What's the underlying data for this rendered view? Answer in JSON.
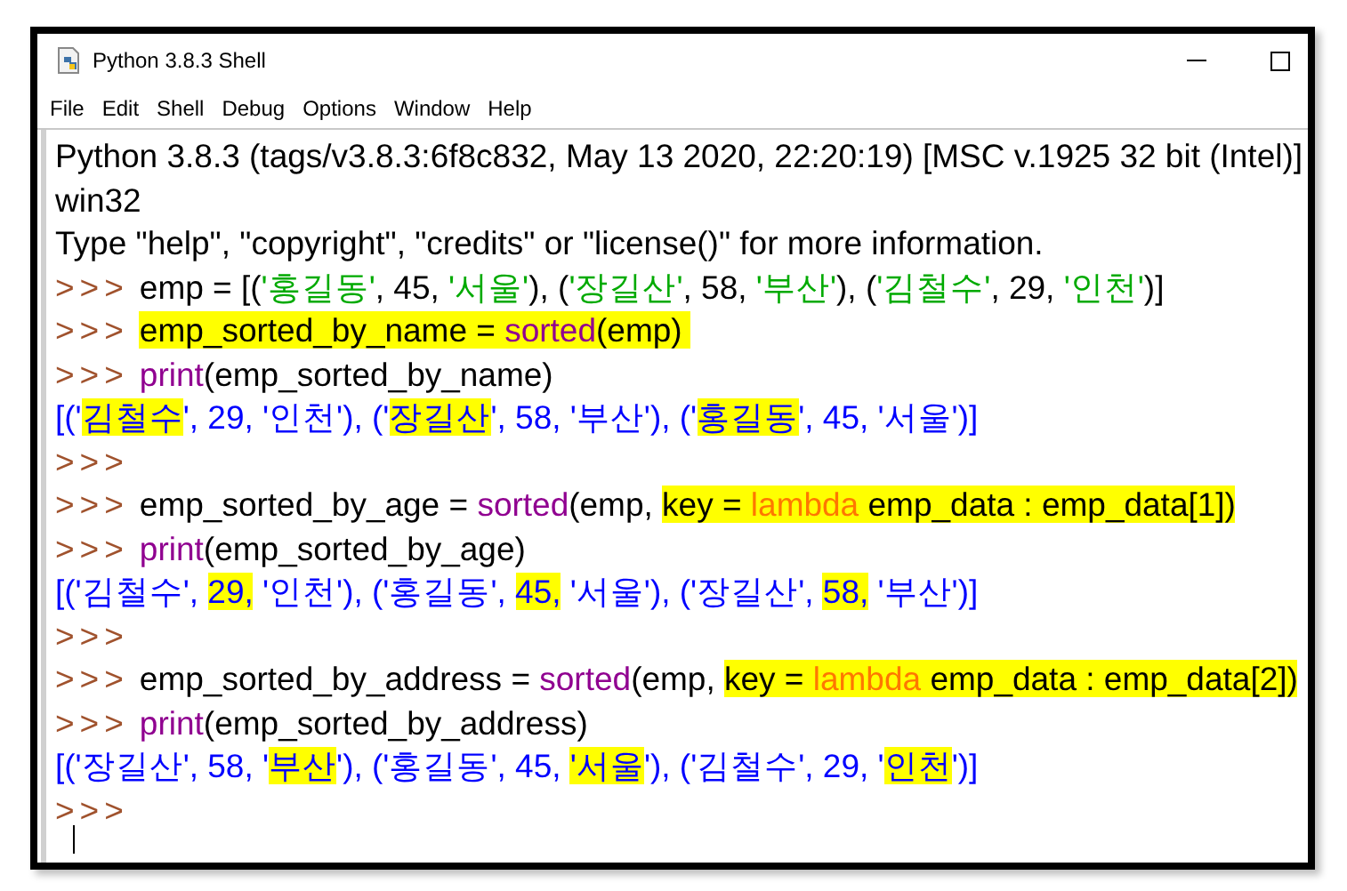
{
  "window": {
    "title": "Python 3.8.3 Shell"
  },
  "menu": [
    "File",
    "Edit",
    "Shell",
    "Debug",
    "Options",
    "Window",
    "Help"
  ],
  "lines": [
    {
      "segments": [
        {
          "text": "Python 3.8.3 (tags/v3.8.3:6f8c832, May 13 2020, 22:20:19) [MSC v.1925 32 bit (Intel)]",
          "kind": "plain",
          "highlighted": false
        }
      ]
    },
    {
      "segments": [
        {
          "text": "win32",
          "kind": "plain",
          "highlighted": false
        }
      ]
    },
    {
      "segments": [
        {
          "text": "Type \"help\", \"copyright\", \"credits\" or \"license()\" for more information.",
          "kind": "plain",
          "highlighted": false
        }
      ]
    },
    {
      "prompt": ">>>",
      "segments": [
        {
          "text": "emp = [(",
          "kind": "plain",
          "highlighted": false
        },
        {
          "text": "'홍길동'",
          "kind": "string",
          "highlighted": false
        },
        {
          "text": ", 45, ",
          "kind": "plain",
          "highlighted": false
        },
        {
          "text": "'서울'",
          "kind": "string",
          "highlighted": false
        },
        {
          "text": "), (",
          "kind": "plain",
          "highlighted": false
        },
        {
          "text": "'장길산'",
          "kind": "string",
          "highlighted": false
        },
        {
          "text": ", 58, ",
          "kind": "plain",
          "highlighted": false
        },
        {
          "text": "'부산'",
          "kind": "string",
          "highlighted": false
        },
        {
          "text": "), (",
          "kind": "plain",
          "highlighted": false
        },
        {
          "text": "'김철수'",
          "kind": "string",
          "highlighted": false
        },
        {
          "text": ", 29, ",
          "kind": "plain",
          "highlighted": false
        },
        {
          "text": "'인천'",
          "kind": "string",
          "highlighted": false
        },
        {
          "text": ")]",
          "kind": "plain",
          "highlighted": false
        }
      ]
    },
    {
      "prompt": ">>>",
      "segments": [
        {
          "text": "emp_sorted_by_name = ",
          "kind": "plain",
          "highlighted": true
        },
        {
          "text": "sorted",
          "kind": "builtin",
          "highlighted": true
        },
        {
          "text": "(emp) ",
          "kind": "plain",
          "highlighted": true
        }
      ]
    },
    {
      "prompt": ">>>",
      "segments": [
        {
          "text": "print",
          "kind": "builtin",
          "highlighted": false
        },
        {
          "text": "(emp_sorted_by_name)",
          "kind": "plain",
          "highlighted": false
        }
      ]
    },
    {
      "segments": [
        {
          "text": "[('",
          "kind": "output",
          "highlighted": false
        },
        {
          "text": "김철수",
          "kind": "output",
          "highlighted": true
        },
        {
          "text": "', 29, '인천'), ('",
          "kind": "output",
          "highlighted": false
        },
        {
          "text": "장길산",
          "kind": "output",
          "highlighted": true
        },
        {
          "text": "', 58, '부산'), ('",
          "kind": "output",
          "highlighted": false
        },
        {
          "text": "홍길동",
          "kind": "output",
          "highlighted": true
        },
        {
          "text": "', 45, '서울')]",
          "kind": "output",
          "highlighted": false
        }
      ]
    },
    {
      "prompt": ">>>"
    },
    {
      "prompt": ">>>",
      "segments": [
        {
          "text": "emp_sorted_by_age = ",
          "kind": "plain",
          "highlighted": false
        },
        {
          "text": "sorted",
          "kind": "builtin",
          "highlighted": false
        },
        {
          "text": "(emp, ",
          "kind": "plain",
          "highlighted": false
        },
        {
          "text": "key = ",
          "kind": "plain",
          "highlighted": true
        },
        {
          "text": "lambda",
          "kind": "keyword",
          "highlighted": true
        },
        {
          "text": " emp_data : emp_data[1])",
          "kind": "plain",
          "highlighted": true
        }
      ]
    },
    {
      "prompt": ">>>",
      "segments": [
        {
          "text": "print",
          "kind": "builtin",
          "highlighted": false
        },
        {
          "text": "(emp_sorted_by_age)",
          "kind": "plain",
          "highlighted": false
        }
      ]
    },
    {
      "segments": [
        {
          "text": "[('김철수', ",
          "kind": "output",
          "highlighted": false
        },
        {
          "text": "29,",
          "kind": "output",
          "highlighted": true
        },
        {
          "text": " '인천'), ('홍길동', ",
          "kind": "output",
          "highlighted": false
        },
        {
          "text": "45,",
          "kind": "output",
          "highlighted": true
        },
        {
          "text": " '서울'), ('장길산', ",
          "kind": "output",
          "highlighted": false
        },
        {
          "text": "58,",
          "kind": "output",
          "highlighted": true
        },
        {
          "text": " '부산')]",
          "kind": "output",
          "highlighted": false
        }
      ]
    },
    {
      "prompt": ">>>"
    },
    {
      "prompt": ">>>",
      "segments": [
        {
          "text": "emp_sorted_by_address = ",
          "kind": "plain",
          "highlighted": false
        },
        {
          "text": "sorted",
          "kind": "builtin",
          "highlighted": false
        },
        {
          "text": "(emp, ",
          "kind": "plain",
          "highlighted": false
        },
        {
          "text": "key = ",
          "kind": "plain",
          "highlighted": true
        },
        {
          "text": "lambda",
          "kind": "keyword",
          "highlighted": true
        },
        {
          "text": " emp_data : emp_data[2])",
          "kind": "plain",
          "highlighted": true
        }
      ]
    },
    {
      "prompt": ">>>",
      "segments": [
        {
          "text": "print",
          "kind": "builtin",
          "highlighted": false
        },
        {
          "text": "(emp_sorted_by_address)",
          "kind": "plain",
          "highlighted": false
        }
      ]
    },
    {
      "segments": [
        {
          "text": "[('장길산', 58, '",
          "kind": "output",
          "highlighted": false
        },
        {
          "text": "부산",
          "kind": "output",
          "highlighted": true
        },
        {
          "text": "'), ('홍길동', 45, ",
          "kind": "output",
          "highlighted": false
        },
        {
          "text": "'서울",
          "kind": "output",
          "highlighted": true
        },
        {
          "text": "'), ('김철수', 29, '",
          "kind": "output",
          "highlighted": false
        },
        {
          "text": "인천",
          "kind": "output",
          "highlighted": true
        },
        {
          "text": "')]",
          "kind": "output",
          "highlighted": false
        }
      ]
    },
    {
      "prompt": ">>>"
    }
  ]
}
